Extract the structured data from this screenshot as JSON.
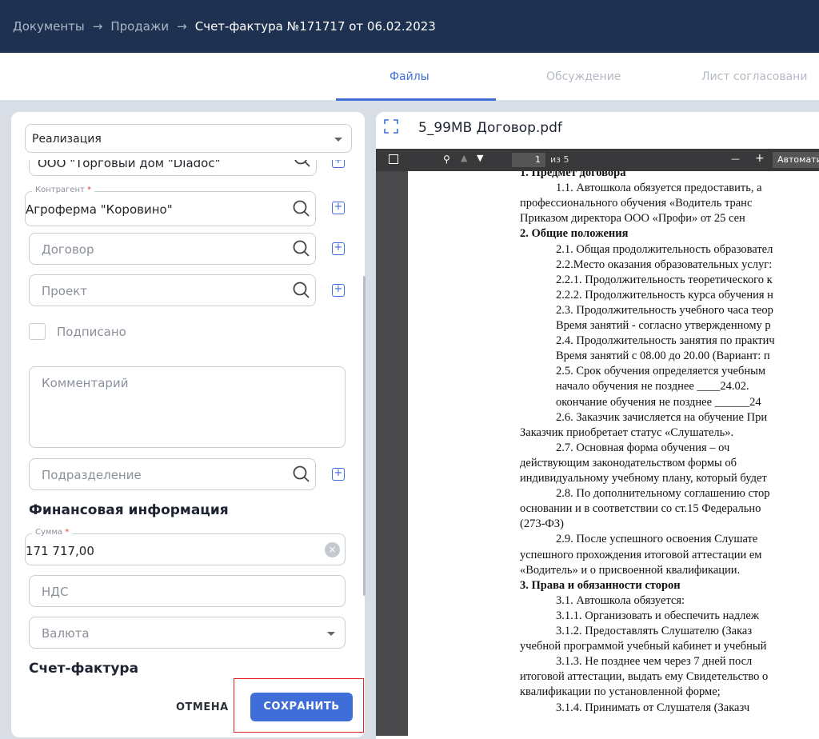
{
  "breadcrumb": {
    "items": [
      "Документы",
      "Продажи"
    ],
    "separator": "→",
    "current": "Счет-фактура №171717 от 06.02.2023"
  },
  "tabs": [
    {
      "label": "Файлы",
      "active": true
    },
    {
      "label": "Обсуждение"
    },
    {
      "label": "Лист согласовани"
    }
  ],
  "form": {
    "type_select": "Реализация",
    "org_value": "ООО \"Торговый дом \"Diadoc\"",
    "counterparty": {
      "label": "Контрагент",
      "required_mark": "*",
      "value": "Агроферма \"Коровино\""
    },
    "contract_placeholder": "Договор",
    "project_placeholder": "Проект",
    "signed_label": "Подписано",
    "comment_placeholder": "Комментарий",
    "department_placeholder": "Подразделение",
    "finance_heading": "Финансовая информация",
    "amount": {
      "label": "Сумма",
      "required_mark": "*",
      "value": "171 717,00"
    },
    "vat_placeholder": "НДС",
    "currency_placeholder": "Валюта",
    "invoice_heading": "Счет-фактура",
    "cancel_label": "ОТМЕНА",
    "save_label": "СОХРАНИТЬ"
  },
  "viewer": {
    "filename": "5_99MB Договор.pdf",
    "toolbar": {
      "page": "1",
      "page_of": "из 5",
      "zoom": "Автомати",
      "minus": "—",
      "plus": "+"
    },
    "lines": [
      {
        "t": "1. Предмет договора",
        "b": true,
        "x": 0
      },
      {
        "t": "1.1. Автошкола обязуется предоставить, а",
        "x": 45
      },
      {
        "t": "профессионального  обучения  «Водитель  транс",
        "x": 0
      },
      {
        "t": "Приказом директора ООО «Профи» от  25 сен",
        "x": 0
      },
      {
        "t": "2. Общие положения",
        "b": true,
        "x": 0
      },
      {
        "t": "2.1. Общая продолжительность образовател",
        "x": 45
      },
      {
        "t": "2.2.Место оказания образовательных услуг:",
        "x": 45
      },
      {
        "t": "2.2.1. Продолжительность теоретического к",
        "x": 45
      },
      {
        "t": "2.2.2. Продолжительность курса обучения н",
        "x": 45
      },
      {
        "t": "2.3. Продолжительность учебного часа теор",
        "x": 45
      },
      {
        "t": "Время занятий - согласно утвержденному р",
        "x": 45
      },
      {
        "t": "2.4. Продолжительность занятия по практич",
        "x": 45
      },
      {
        "t": "Время занятий с 08.00 до 20.00 (Вариант: п",
        "x": 45
      },
      {
        "t": "2.5.  Срок обучения определяется учебным",
        "x": 45
      },
      {
        "t": "начало обучения не позднее  ____24.02.",
        "x": 45
      },
      {
        "t": "окончание обучения не позднее  ______24",
        "x": 45
      },
      {
        "t": "2.6. Заказчик зачисляется на обучение При",
        "x": 45
      },
      {
        "t": "Заказчик приобретает статус «Слушатель».",
        "x": 0
      },
      {
        "t": "2.7.  Основная  форма  обучения  –  оч",
        "x": 45
      },
      {
        "t": "действующим   законодательством   формы   об",
        "x": 0
      },
      {
        "t": "индивидуальному учебному плану, который будет",
        "x": 0
      },
      {
        "t": "2.8. По дополнительному соглашению стор",
        "x": 45
      },
      {
        "t": "основании и в соответствии со ст.15 Федерально",
        "x": 0
      },
      {
        "t": "(273-ФЗ)",
        "x": 0
      },
      {
        "t": "2.9.  После  успешного  освоения  Слушате",
        "x": 45
      },
      {
        "t": "успешного прохождения итоговой аттестации ем",
        "x": 0
      },
      {
        "t": "«Водитель» и о присвоенной квалификации.",
        "x": 0
      },
      {
        "t": "3. Права и обязанности сторон",
        "b": true,
        "x": 0
      },
      {
        "t": "3.1. Автошкола обязуется:",
        "x": 45
      },
      {
        "t": "3.1.1.      Организовать и обеспечить надлеж",
        "x": 45
      },
      {
        "t": "3.1.2.      Предоставлять Слушателю (Заказ",
        "x": 45
      },
      {
        "t": "учебной программой учебный кабинет и учебный",
        "x": 0
      },
      {
        "t": "3.1.3.      Не позднее чем через 7 дней посл",
        "x": 45
      },
      {
        "t": "итоговой аттестации, выдать ему Свидетельство о",
        "x": 0
      },
      {
        "t": "квалификации по установленной форме;",
        "x": 0
      },
      {
        "t": "3.1.4.      Принимать от Слушателя (Заказч",
        "x": 45
      }
    ]
  }
}
